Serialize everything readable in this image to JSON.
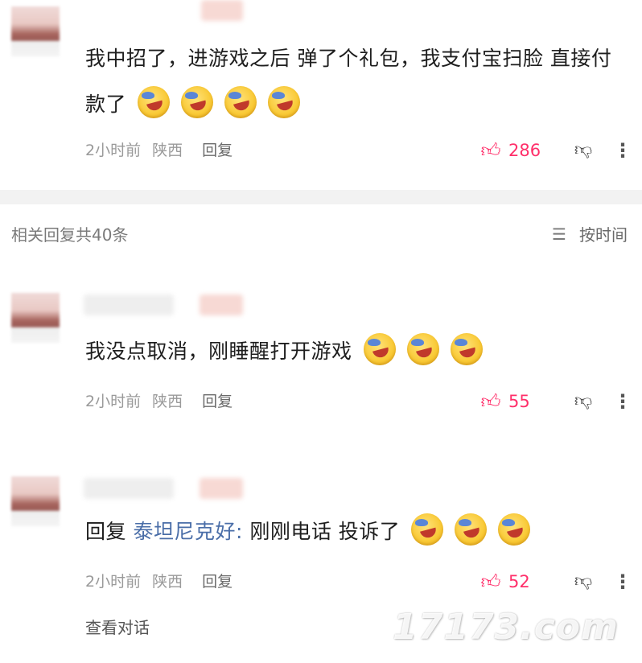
{
  "comments": {
    "c1": {
      "text": "我中招了，进游戏之后 弹了个礼包，我支付宝扫脸 直接付款了",
      "time": "2小时前",
      "location": "陕西",
      "reply_label": "回复",
      "likes": "286"
    },
    "c2": {
      "text": "我没点取消，刚睡醒打开游戏",
      "time": "2小时前",
      "location": "陕西",
      "reply_label": "回复",
      "likes": "55"
    },
    "c3": {
      "prefix": "回复",
      "target": "泰坦尼克好:",
      "text": " 刚刚电话 投诉了",
      "time": "2小时前",
      "location": "陕西",
      "reply_label": "回复",
      "likes": "52"
    }
  },
  "section": {
    "title": "相关回复共40条",
    "sort_label": "按时间"
  },
  "view_conversation": "查看对话",
  "watermark": "17173.com",
  "icons": {
    "like": "thumbs-up-icon",
    "dislike": "thumbs-down-icon",
    "more": "more-vertical-icon",
    "sort": "menu-lines-icon",
    "emoji": "crying-face-emoji"
  },
  "colors": {
    "like": "#ff2f6a",
    "reply_target": "#4a6ea8",
    "meta": "#9a9a9a"
  }
}
